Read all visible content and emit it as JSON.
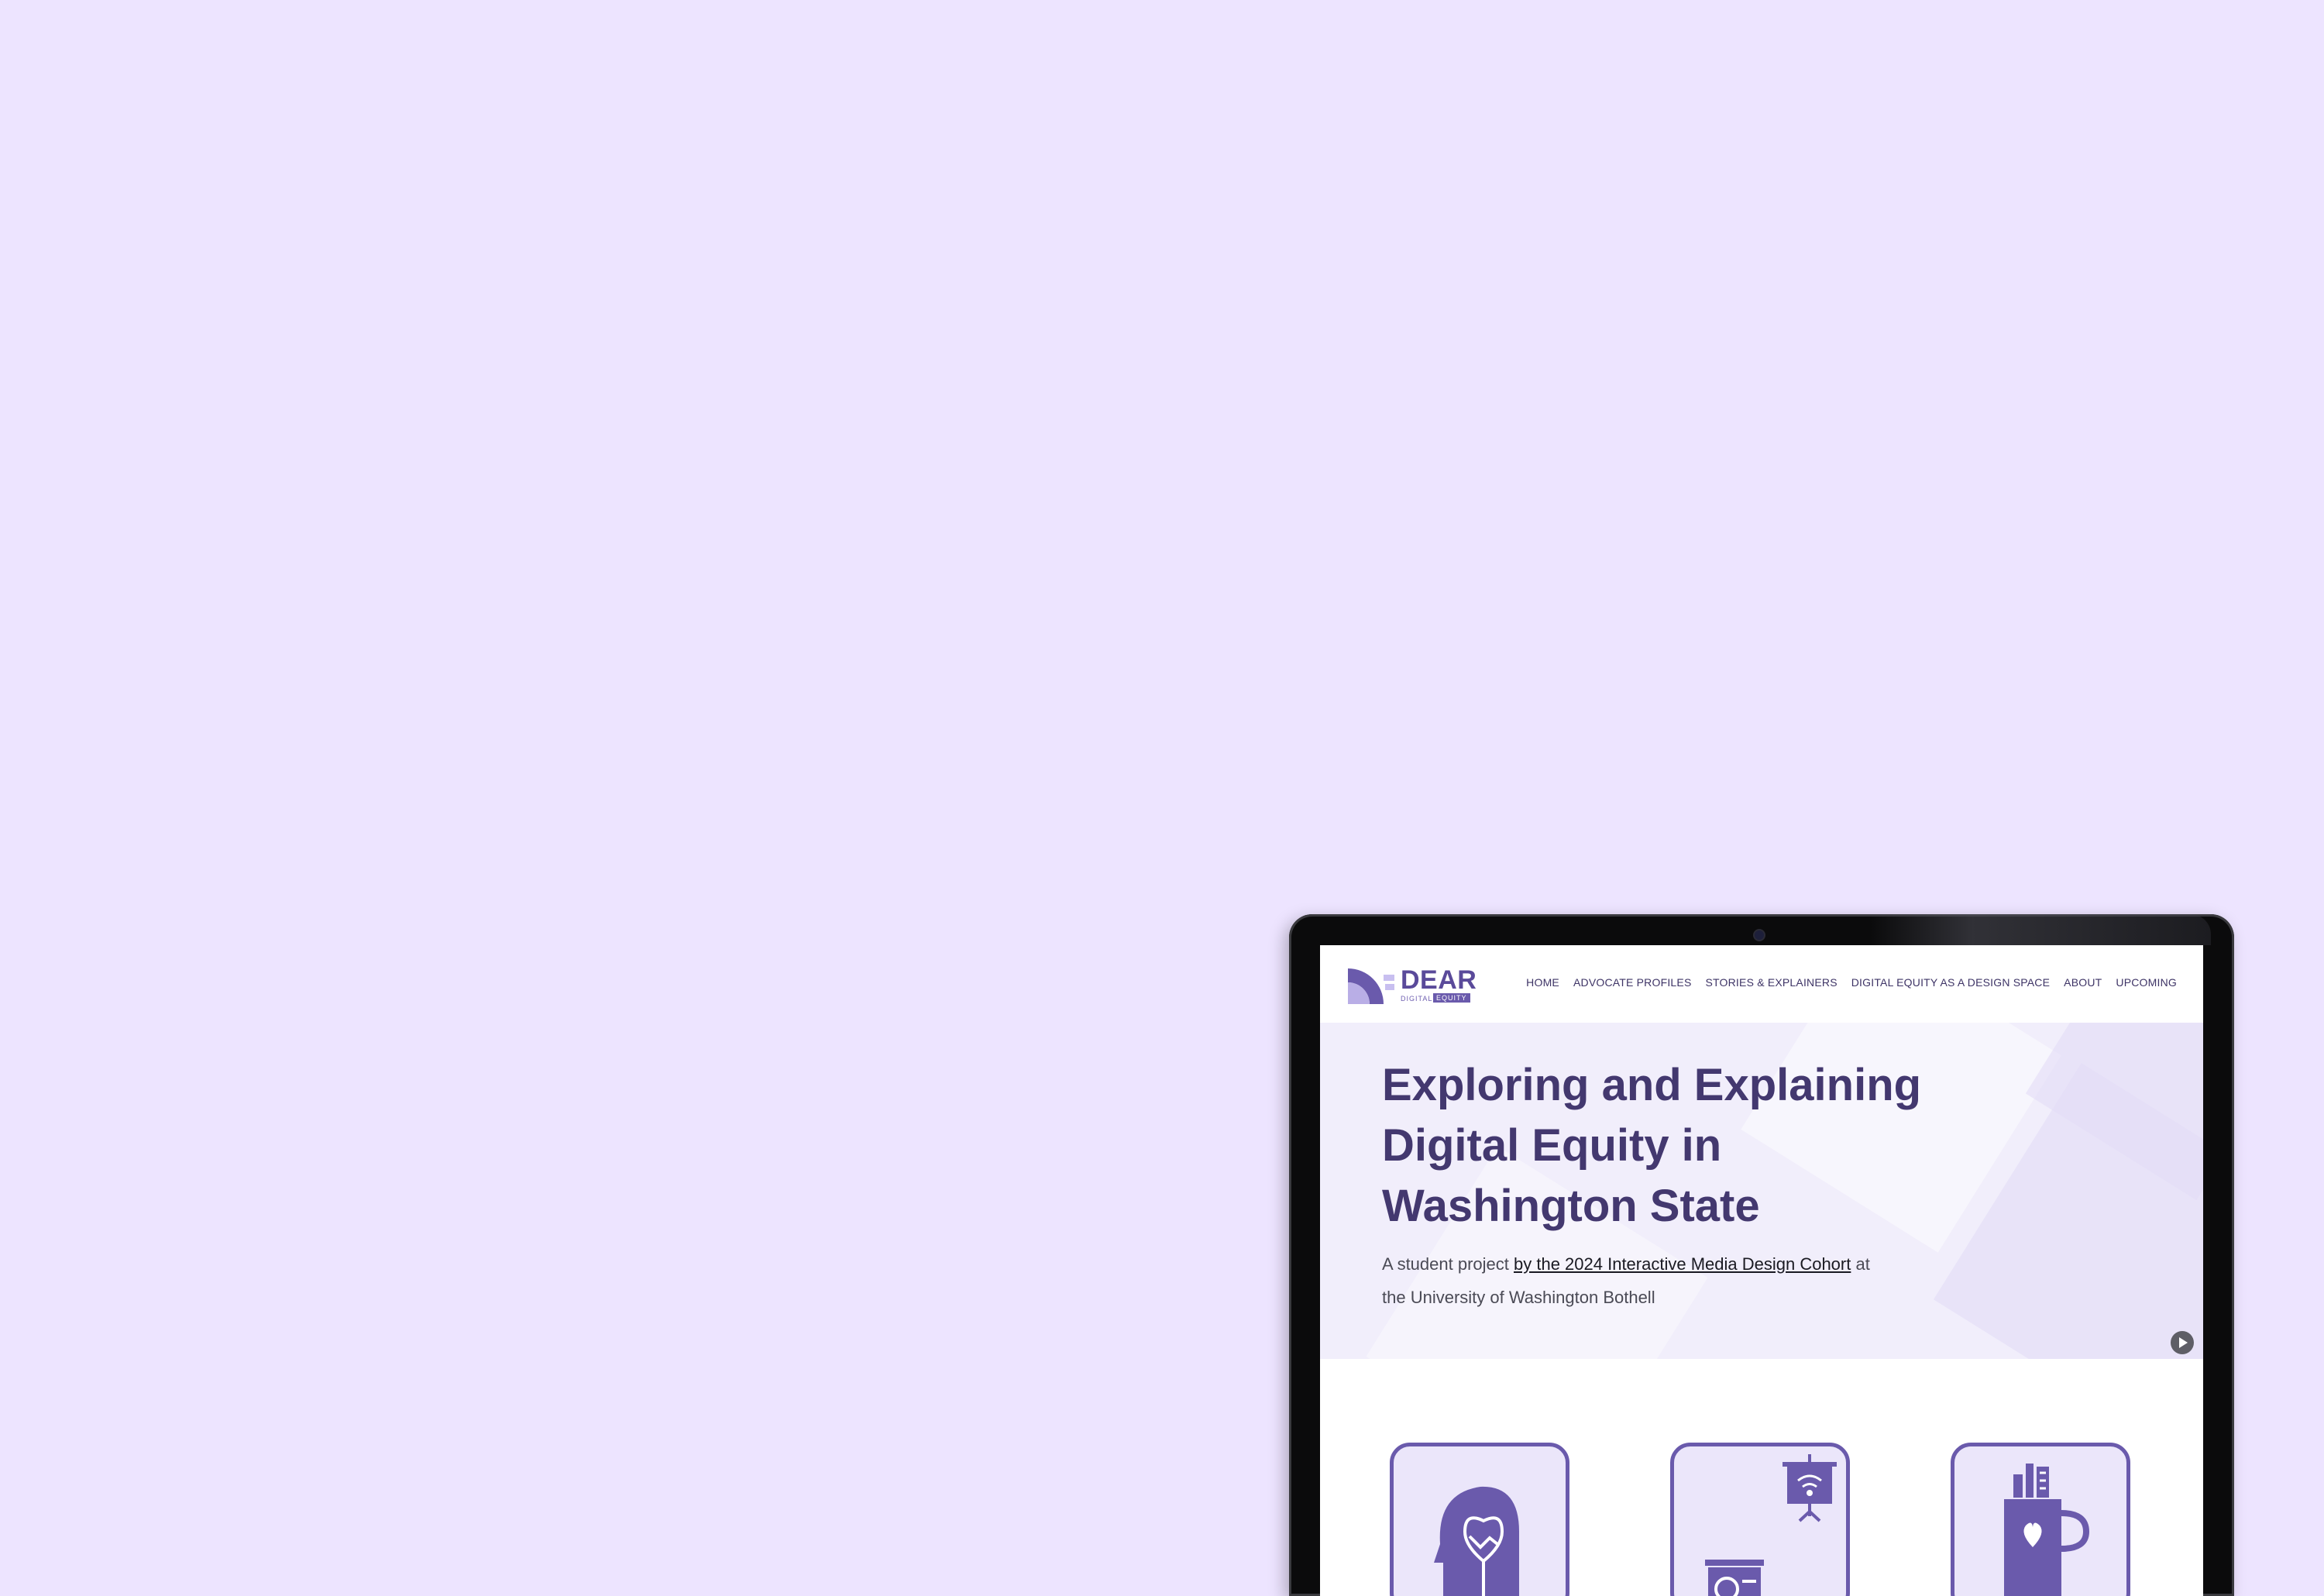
{
  "site": {
    "logo": {
      "word": "DEAR",
      "sub_left": "DIGITAL",
      "sub_right": "EQUITY"
    },
    "nav": [
      "HOME",
      "ADVOCATE PROFILES",
      "STORIES & EXPLAINERS",
      "DIGITAL EQUITY AS A DESIGN SPACE",
      "ABOUT",
      "UPCOMING"
    ]
  },
  "hero": {
    "title": "Exploring and Explaining Digital Equity in Washington State",
    "subtitle_prefix": "A student project ",
    "subtitle_link": "by the 2024 Interactive Media Design Cohort",
    "subtitle_suffix": " at the University of Washington Bothell"
  },
  "cards": [
    {
      "icon": "head-handshake-icon"
    },
    {
      "icon": "presentation-wifi-icon"
    },
    {
      "icon": "mug-heart-icon"
    }
  ],
  "colors": {
    "background": "#ede4ff",
    "brand": "#6a5aac",
    "title": "#43386f"
  }
}
